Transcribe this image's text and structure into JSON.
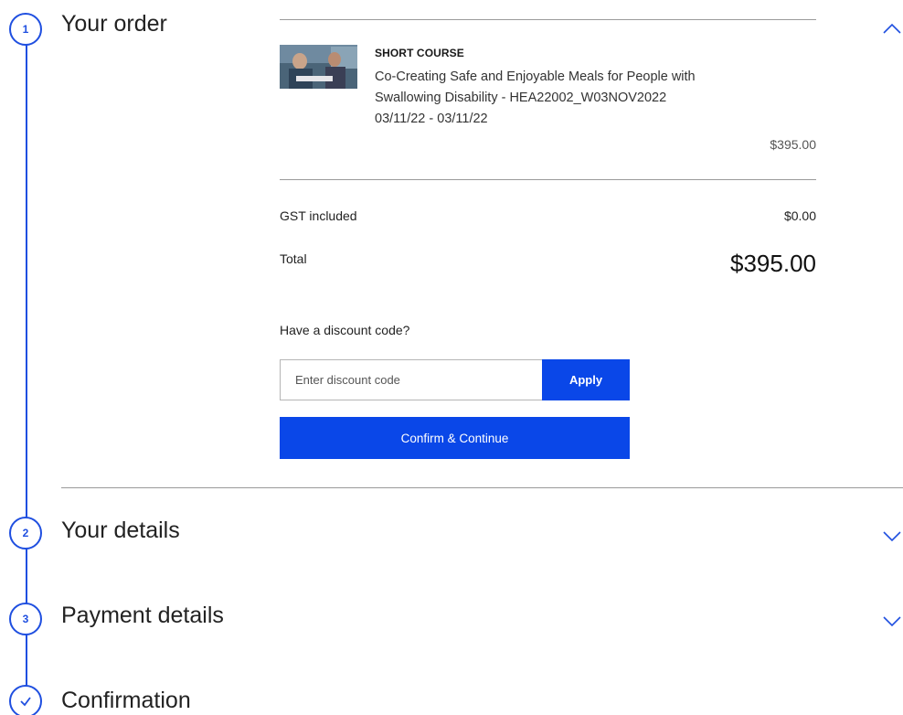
{
  "steps": [
    {
      "number": "1",
      "title": "Your order"
    },
    {
      "number": "2",
      "title": "Your details"
    },
    {
      "number": "3",
      "title": "Payment details"
    },
    {
      "number": "check",
      "title": "Confirmation"
    }
  ],
  "order": {
    "course_type": "SHORT COURSE",
    "course_title_line1": "Co-Creating Safe and Enjoyable Meals for People with",
    "course_title_line2": "Swallowing Disability - HEA22002_W03NOV2022",
    "course_dates": "03/11/22 - 03/11/22",
    "item_price": "$395.00",
    "gst_label": "GST included",
    "gst_value": "$0.00",
    "total_label": "Total",
    "total_value": "$395.00"
  },
  "discount": {
    "label": "Have a discount code?",
    "placeholder": "Enter discount code",
    "apply_label": "Apply"
  },
  "confirm_label": "Confirm & Continue",
  "colors": {
    "accent": "#0a47e8",
    "step": "#1f4fe0",
    "divider": "#9a9a9a"
  }
}
